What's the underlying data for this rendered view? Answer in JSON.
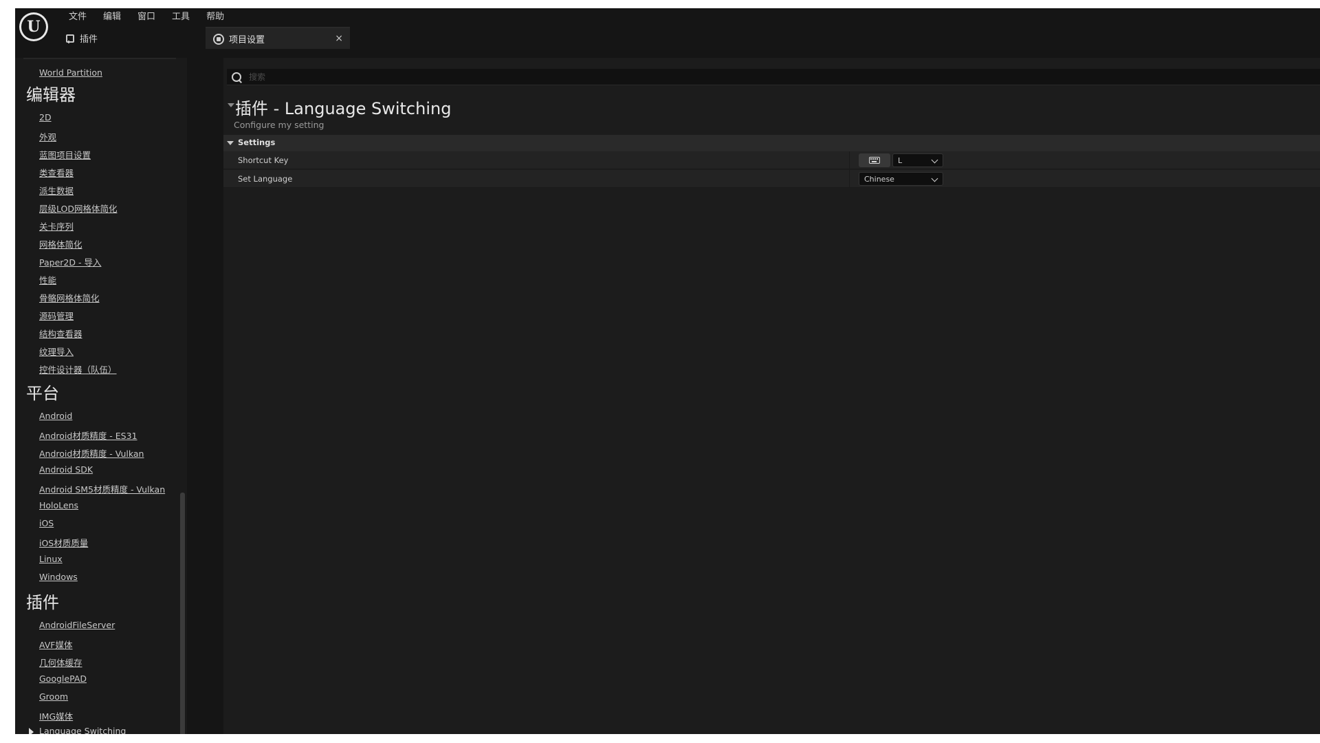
{
  "menu": [
    "文件",
    "编辑",
    "窗口",
    "工具",
    "帮助"
  ],
  "plugin_label": "插件",
  "tab": {
    "label": "项目设置",
    "close": "×"
  },
  "sidebar": {
    "top_item": "World Partition",
    "sections": [
      {
        "title": "编辑器",
        "items": [
          "2D",
          "外观",
          "蓝图项目设置",
          "类查看器",
          "派生数据",
          "层级LOD网格体简化",
          "关卡序列",
          "网格体简化",
          "Paper2D - 导入",
          "性能",
          "骨骼网格体简化",
          "源码管理",
          "结构查看器",
          "纹理导入",
          "控件设计器（队伍）"
        ]
      },
      {
        "title": "平台",
        "items": [
          "Android",
          "Android材质精度 - ES31",
          "Android材质精度 - Vulkan",
          "Android SDK",
          "Android SM5材质精度 - Vulkan",
          "HoloLens",
          "iOS",
          "iOS材质质量",
          "Linux",
          "Windows"
        ]
      },
      {
        "title": "插件",
        "items": [
          "AndroidFileServer",
          "AVF媒体",
          "几何体缓存",
          "GooglePAD",
          "Groom",
          "IMG媒体",
          "Language Switching"
        ]
      }
    ],
    "selected": "Language Switching"
  },
  "search": {
    "placeholder": "搜索"
  },
  "section": {
    "title": "插件 - Language Switching",
    "description": "Configure my setting"
  },
  "category": "Settings",
  "properties": {
    "shortcut": {
      "label": "Shortcut Key",
      "value": "L"
    },
    "language": {
      "label": "Set Language",
      "value": "Chinese"
    }
  }
}
